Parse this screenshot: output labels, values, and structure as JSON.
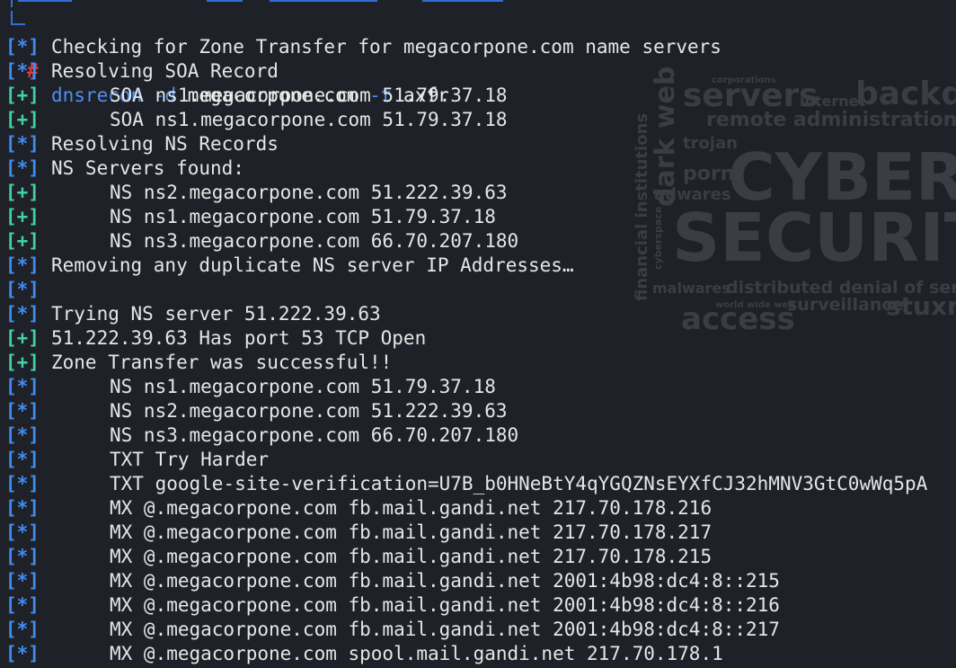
{
  "colors": {
    "background": "#1f2128",
    "info_tag": "#3f8cf0",
    "plus_tag": "#3fd1a8",
    "prompt_hash": "#e03a3a",
    "command": "#4f8ff0",
    "text": "#e6e6e6",
    "wallpaper": "#3b3d44"
  },
  "prompt": {
    "symbol": "#",
    "command": "dnsrecon",
    "flag_domain": "-d",
    "domain": "megacorpone.com",
    "flag_type": "-t",
    "type": "axfr"
  },
  "wallpaper_words": {
    "w1": "CYBER",
    "w2": "SECURITY",
    "w3": "servers",
    "w4": "backdoor",
    "w5": "remote administration tools",
    "w6": "dark web",
    "w7": "trojan",
    "w8": "porn",
    "w9": "adwares",
    "w10": "internet",
    "w11": "financial institutions",
    "w12": "malwares",
    "w13": "distributed denial of service",
    "w14": "surveillance",
    "w15": "stuxnet",
    "w16": "access",
    "w17": "cyberspace",
    "w18": "world wide web",
    "w19": "corporations"
  },
  "output": [
    {
      "tag": "[*]",
      "kind": "info",
      "indent": false,
      "text": "Checking for Zone Transfer for megacorpone.com name servers"
    },
    {
      "tag": "[*]",
      "kind": "info",
      "indent": false,
      "text": "Resolving SOA Record"
    },
    {
      "tag": "[+]",
      "kind": "plus",
      "indent": true,
      "text": "SOA ns1.megacorpone.com 51.79.37.18"
    },
    {
      "tag": "[+]",
      "kind": "plus",
      "indent": true,
      "text": "SOA ns1.megacorpone.com 51.79.37.18"
    },
    {
      "tag": "[*]",
      "kind": "info",
      "indent": false,
      "text": "Resolving NS Records"
    },
    {
      "tag": "[*]",
      "kind": "info",
      "indent": false,
      "text": "NS Servers found:"
    },
    {
      "tag": "[+]",
      "kind": "plus",
      "indent": true,
      "text": "NS ns2.megacorpone.com 51.222.39.63"
    },
    {
      "tag": "[+]",
      "kind": "plus",
      "indent": true,
      "text": "NS ns1.megacorpone.com 51.79.37.18"
    },
    {
      "tag": "[+]",
      "kind": "plus",
      "indent": true,
      "text": "NS ns3.megacorpone.com 66.70.207.180"
    },
    {
      "tag": "[*]",
      "kind": "info",
      "indent": false,
      "text": "Removing any duplicate NS server IP Addresses…"
    },
    {
      "tag": "[*]",
      "kind": "info",
      "indent": false,
      "text": ""
    },
    {
      "tag": "[*]",
      "kind": "info",
      "indent": false,
      "text": "Trying NS server 51.222.39.63"
    },
    {
      "tag": "[+]",
      "kind": "plus",
      "indent": false,
      "text": "51.222.39.63 Has port 53 TCP Open"
    },
    {
      "tag": "[+]",
      "kind": "plus",
      "indent": false,
      "text": "Zone Transfer was successful!!"
    },
    {
      "tag": "[*]",
      "kind": "info",
      "indent": true,
      "text": "NS ns1.megacorpone.com 51.79.37.18"
    },
    {
      "tag": "[*]",
      "kind": "info",
      "indent": true,
      "text": "NS ns2.megacorpone.com 51.222.39.63"
    },
    {
      "tag": "[*]",
      "kind": "info",
      "indent": true,
      "text": "NS ns3.megacorpone.com 66.70.207.180"
    },
    {
      "tag": "[*]",
      "kind": "info",
      "indent": true,
      "text": "TXT Try Harder"
    },
    {
      "tag": "[*]",
      "kind": "info",
      "indent": true,
      "text": "TXT google-site-verification=U7B_b0HNeBtY4qYGQZNsEYXfCJ32hMNV3GtC0wWq5pA"
    },
    {
      "tag": "[*]",
      "kind": "info",
      "indent": true,
      "text": "MX @.megacorpone.com fb.mail.gandi.net 217.70.178.216"
    },
    {
      "tag": "[*]",
      "kind": "info",
      "indent": true,
      "text": "MX @.megacorpone.com fb.mail.gandi.net 217.70.178.217"
    },
    {
      "tag": "[*]",
      "kind": "info",
      "indent": true,
      "text": "MX @.megacorpone.com fb.mail.gandi.net 217.70.178.215"
    },
    {
      "tag": "[*]",
      "kind": "info",
      "indent": true,
      "text": "MX @.megacorpone.com fb.mail.gandi.net 2001:4b98:dc4:8::215"
    },
    {
      "tag": "[*]",
      "kind": "info",
      "indent": true,
      "text": "MX @.megacorpone.com fb.mail.gandi.net 2001:4b98:dc4:8::216"
    },
    {
      "tag": "[*]",
      "kind": "info",
      "indent": true,
      "text": "MX @.megacorpone.com fb.mail.gandi.net 2001:4b98:dc4:8::217"
    },
    {
      "tag": "[*]",
      "kind": "info",
      "indent": true,
      "text": "MX @.megacorpone.com spool.mail.gandi.net 217.70.178.1"
    }
  ]
}
